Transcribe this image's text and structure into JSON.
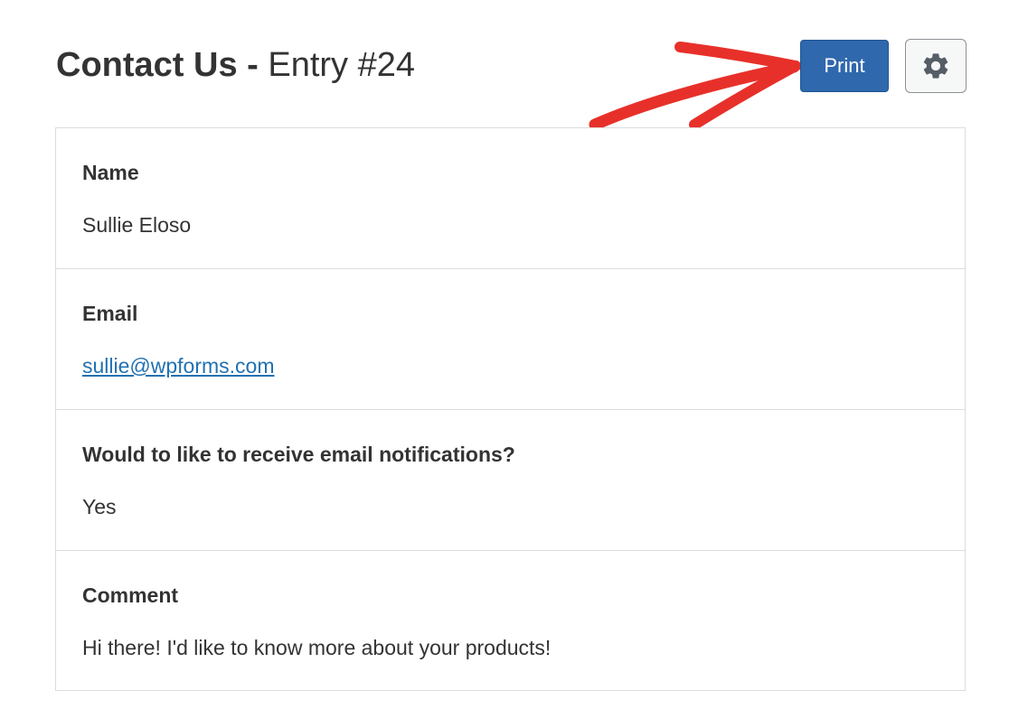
{
  "header": {
    "form_name": "Contact Us -",
    "entry_label": "Entry #24",
    "print_label": "Print",
    "settings_icon": "gear-icon"
  },
  "annotation": {
    "arrow_color": "#e8302a",
    "target": "print-button"
  },
  "colors": {
    "primary_button": "#2f68ac",
    "link": "#2271b1",
    "border": "#dcdcde"
  },
  "fields": [
    {
      "label": "Name",
      "value": "Sullie Eloso"
    },
    {
      "label": "Email",
      "value": "sullie@wpforms.com"
    },
    {
      "label": "Would to like to receive email notifications?",
      "value": "Yes"
    },
    {
      "label": "Comment",
      "value": "Hi there! I'd like to know more about your products!"
    }
  ]
}
